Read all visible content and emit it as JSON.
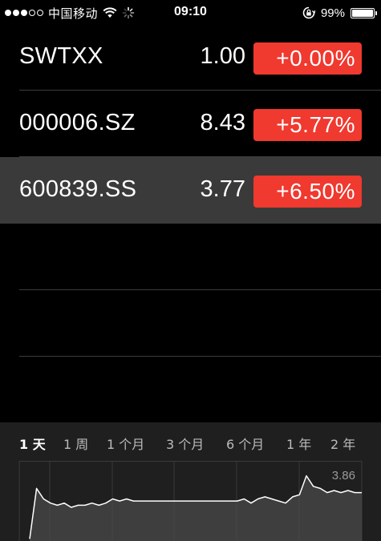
{
  "status_bar": {
    "signal_dots_filled": 3,
    "signal_dots_total": 5,
    "carrier": "中国移动",
    "time": "09:10",
    "battery": "99%",
    "battery_level": 0.99,
    "icons": [
      "wifi-icon",
      "activity-spinner-icon",
      "rotation-lock-icon",
      "battery-icon"
    ]
  },
  "stocks": [
    {
      "symbol": "SWTXX",
      "price": "1.00",
      "change": "+0.00%",
      "selected": false
    },
    {
      "symbol": "000006.SZ",
      "price": "8.43",
      "change": "+5.77%",
      "selected": false
    },
    {
      "symbol": "600839.SS",
      "price": "3.77",
      "change": "+6.50%",
      "selected": true
    }
  ],
  "colors": {
    "badge_red": "#f0392f",
    "selected_row": "#3a3a3a",
    "panel_bg": "#1f1f1f"
  },
  "range_tabs": [
    {
      "label": "1 天",
      "active": true
    },
    {
      "label": "1 周",
      "active": false
    },
    {
      "label": "1 个月",
      "active": false
    },
    {
      "label": "3 个月",
      "active": false
    },
    {
      "label": "6 个月",
      "active": false
    },
    {
      "label": "1 年",
      "active": false
    },
    {
      "label": "2 年",
      "active": false
    }
  ],
  "chart_data": {
    "type": "area",
    "period": "1 天",
    "max_label": "3.86",
    "y_max": 3.86,
    "y_baseline": 3.54,
    "x": [
      0,
      1,
      2,
      3,
      4,
      5,
      6,
      7,
      8,
      9,
      10,
      11,
      12,
      13,
      14,
      15,
      16,
      17,
      18,
      19,
      20,
      21,
      22,
      23,
      24,
      25,
      26,
      27,
      28,
      29,
      30,
      31,
      32,
      33,
      34,
      35,
      36,
      37,
      38,
      39,
      40,
      41,
      42,
      43,
      44,
      45,
      46,
      47,
      48
    ],
    "values": [
      3.55,
      3.79,
      3.74,
      3.72,
      3.71,
      3.72,
      3.7,
      3.71,
      3.71,
      3.72,
      3.71,
      3.72,
      3.74,
      3.73,
      3.74,
      3.73,
      3.73,
      3.73,
      3.73,
      3.73,
      3.73,
      3.73,
      3.73,
      3.73,
      3.73,
      3.73,
      3.73,
      3.73,
      3.73,
      3.73,
      3.73,
      3.74,
      3.72,
      3.74,
      3.75,
      3.74,
      3.73,
      3.72,
      3.75,
      3.76,
      3.85,
      3.8,
      3.79,
      3.77,
      3.78,
      3.77,
      3.78,
      3.77,
      3.77
    ],
    "gridlines": true
  }
}
